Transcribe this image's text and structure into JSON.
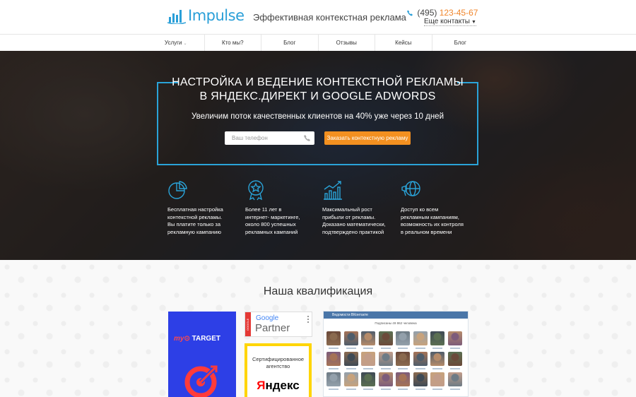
{
  "header": {
    "logo_text": "Impulse",
    "tagline": "Эффективная контекстная реклама",
    "phone_code": "(495)",
    "phone_number": "123-45-67",
    "more_contacts": "Еще контакты",
    "accent_color": "#2a9fd8",
    "phone_color": "#f0862c"
  },
  "nav": {
    "items": [
      {
        "label": "Услуги",
        "has_dropdown": true
      },
      {
        "label": "Кто мы?"
      },
      {
        "label": "Блог"
      },
      {
        "label": "Отзывы"
      },
      {
        "label": "Кейсы"
      },
      {
        "label": "Блог"
      }
    ]
  },
  "hero": {
    "title_line1": "НАСТРОЙКА И ВЕДЕНИЕ КОНТЕКСТНОЙ РЕКЛАМЫ",
    "title_line2": "В ЯНДЕКС.ДИРЕКТ И GOOGLE ADWORDS",
    "subtitle": "Увеличим поток качественных клиентов на 40% уже через 10 дней",
    "phone_placeholder": "Ваш телефон",
    "cta_label": "Заказать контекстную рекламу",
    "cta_color": "#f39020",
    "frame_color": "#2aa3d8"
  },
  "features": [
    {
      "icon": "pie-chart-coin-icon",
      "line1": "Бесплатная настройка",
      "line2": "контекстной рекламы.",
      "line3": "Вы платите только за",
      "line4": "рекламную кампанию"
    },
    {
      "icon": "award-medal-icon",
      "line1": "Более 11 лет в",
      "line2": "интернет- маркетинге,",
      "line3": "около 800 успешных",
      "line4": "рекламных кампаний"
    },
    {
      "icon": "growth-chart-icon",
      "line1": "Максимальный рост",
      "line2": "прибыли от рекламы.",
      "line3": "Доказано математически,",
      "line4": "подтверждено практикой"
    },
    {
      "icon": "megaphone-globe-icon",
      "line1": "Доступ ко всем",
      "line2": "рекламным кампаниям,",
      "line3": "возможность их контроля",
      "line4": "в реальном времени"
    }
  ],
  "qualification": {
    "title": "Наша квалификация",
    "mytarget": {
      "my": "my",
      "target": "TARGET"
    },
    "google": {
      "side": "GOOGLE",
      "word": "Google",
      "partner": "Partner"
    },
    "yandex": {
      "cert_line1": "Сертифицированное",
      "cert_line2": "агентство",
      "brand": "Яндекс"
    },
    "vk": {
      "header": "Ведомости ВКонтакте",
      "subscribers": "Подписаны 49 862 человека"
    }
  }
}
